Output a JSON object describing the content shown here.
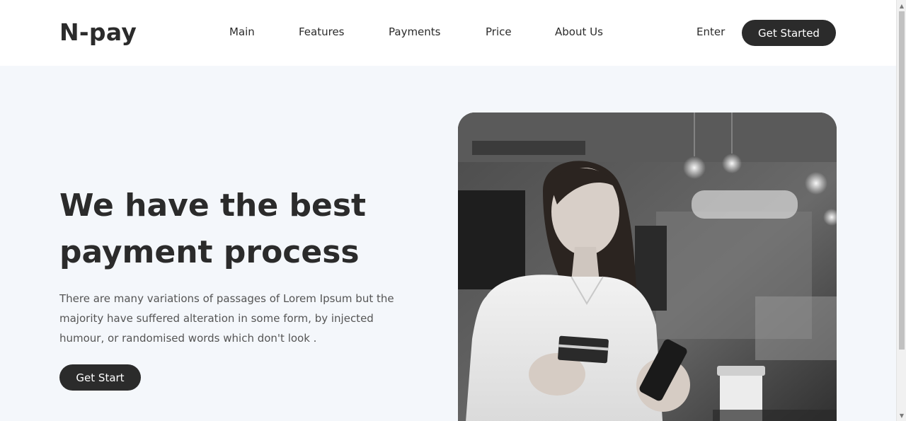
{
  "header": {
    "logo": "N-pay",
    "nav": [
      "Main",
      "Features",
      "Payments",
      "Price",
      "About Us"
    ],
    "enter": "Enter",
    "cta": "Get Started"
  },
  "hero": {
    "title": "We have the best payment process",
    "description": "There are many variations of passages of Lorem Ipsum but the majority have suffered alteration in some form, by injected humour, or randomised words which don't look .",
    "cta": "Get Start"
  },
  "scrollbar": {
    "up_icon": "triangle-up-icon",
    "down_icon": "triangle-down-icon"
  },
  "colors": {
    "page_background": "#f4f7fb",
    "header_background": "#ffffff",
    "text": "#2b2b2b",
    "button": "#2b2b2b",
    "button_text": "#ffffff"
  }
}
